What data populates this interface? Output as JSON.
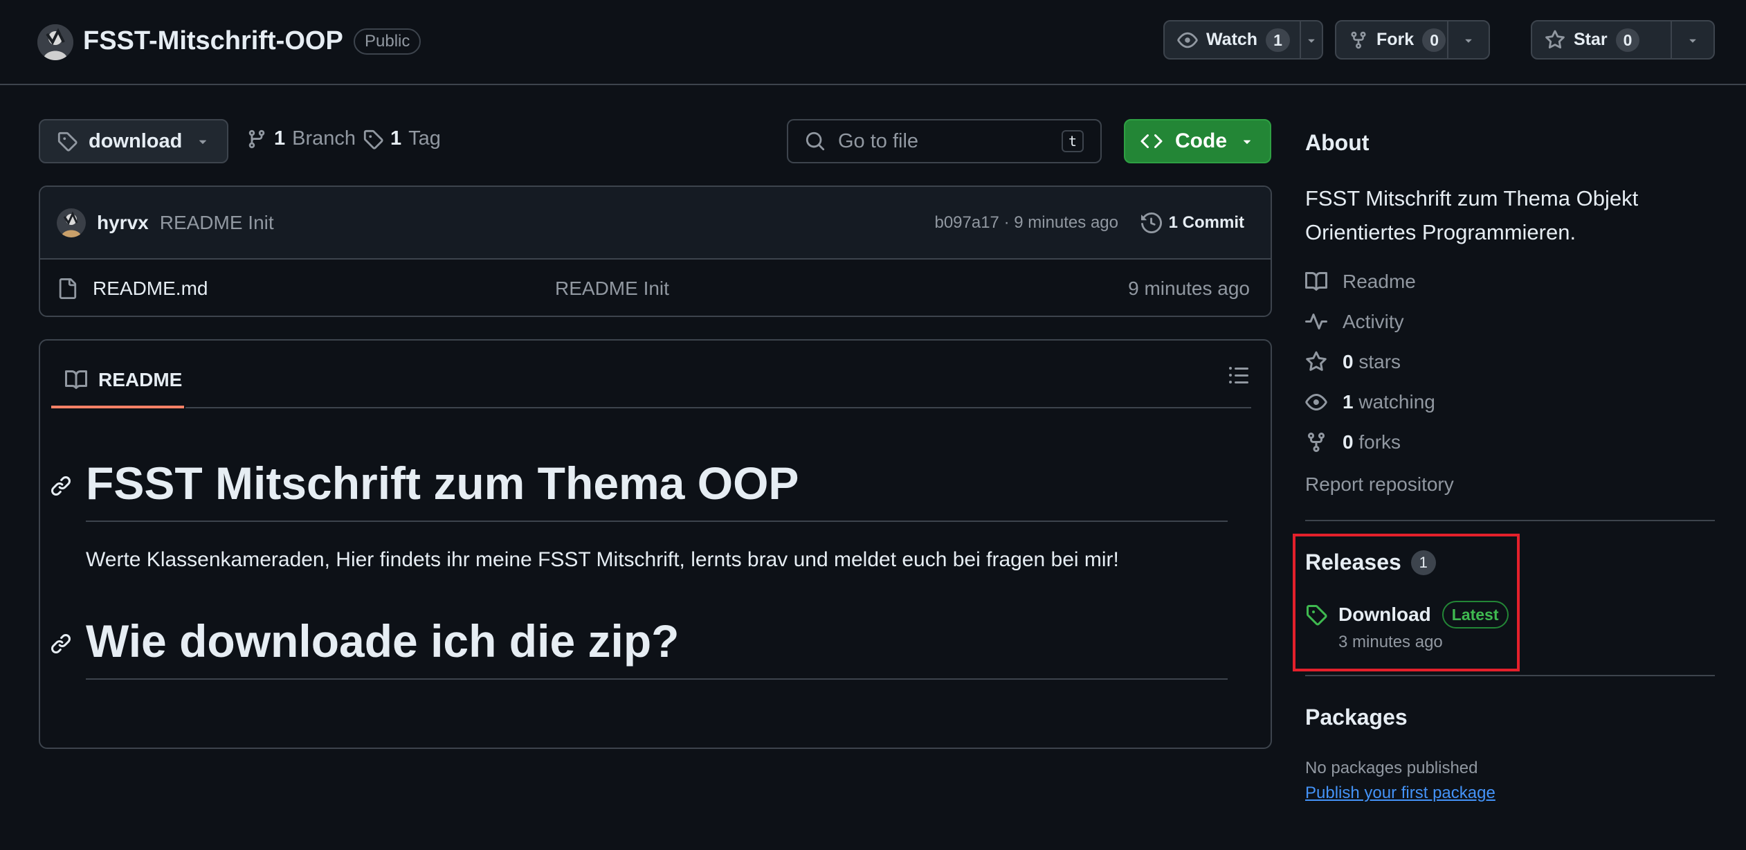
{
  "repo": {
    "name": "FSST-Mitschrift-OOP",
    "visibility": "Public"
  },
  "actions": {
    "watch": {
      "label": "Watch",
      "count": "1"
    },
    "fork": {
      "label": "Fork",
      "count": "0"
    },
    "star": {
      "label": "Star",
      "count": "0"
    }
  },
  "toolbar": {
    "branch": "download",
    "branch_count": "1",
    "branch_label": "Branch",
    "tag_count": "1",
    "tag_label": "Tag",
    "search_placeholder": "Go to file",
    "search_shortcut": "t",
    "code_label": "Code"
  },
  "latest_commit": {
    "author": "hyrvx",
    "message": "README Init",
    "meta": "b097a17 · 9 minutes ago",
    "commit_count": "1 Commit"
  },
  "files": [
    {
      "name": "README.md",
      "message": "README Init",
      "time": "9 minutes ago"
    }
  ],
  "readme": {
    "tab_label": "README",
    "heading1": "FSST Mitschrift zum Thema OOP",
    "paragraph": "Werte Klassenkameraden, Hier findets ihr meine FSST Mitschrift, lernts brav und meldet euch bei fragen bei mir!",
    "heading2": "Wie downloade ich die zip?"
  },
  "sidebar": {
    "about_title": "About",
    "description": "FSST Mitschrift zum Thema Objekt Orientiertes Programmieren.",
    "items": [
      {
        "icon": "book-icon",
        "label": "Readme",
        "count": ""
      },
      {
        "icon": "pulse-icon",
        "label": "Activity",
        "count": ""
      },
      {
        "icon": "star-icon",
        "label": "stars",
        "count": "0"
      },
      {
        "icon": "eye-icon",
        "label": "watching",
        "count": "1"
      },
      {
        "icon": "fork-icon",
        "label": "forks",
        "count": "0"
      }
    ],
    "report": "Report repository",
    "releases": {
      "title": "Releases",
      "count": "1",
      "name": "Download",
      "badge": "Latest",
      "time": "3 minutes ago"
    },
    "packages": {
      "title": "Packages",
      "empty": "No packages published",
      "link": "Publish your first package"
    }
  },
  "colors": {
    "background": "#0d1117",
    "accent_green": "#238636",
    "link_blue": "#4493f8",
    "highlight_red": "#e3202b",
    "tab_underline": "#f78166"
  }
}
